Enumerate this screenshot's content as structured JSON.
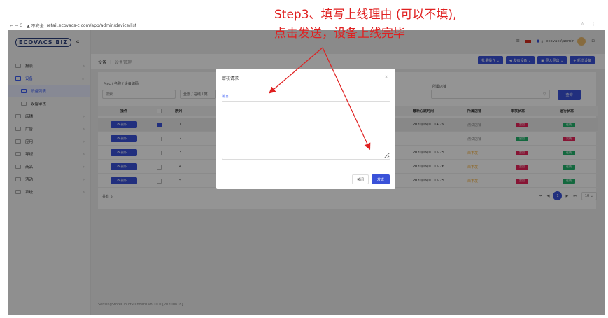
{
  "browser": {
    "nav": "← → C",
    "secure": "▲ 不安全",
    "url": "retail.ecovacs-c.com/app/admin/device\\list",
    "tools": "☆ ⋮"
  },
  "captions": {
    "line1": "Step3、填写上线理由 (可以不填),",
    "line2": "点击发送，设备上线完毕"
  },
  "logo": {
    "text": "ECOVACS BIZ",
    "collapse": "«"
  },
  "sidebar": {
    "items": [
      {
        "label": "报表"
      },
      {
        "label": "设备"
      },
      {
        "label": "设备列表"
      },
      {
        "label": "设备审核"
      },
      {
        "label": "店铺"
      },
      {
        "label": "广告"
      },
      {
        "label": "应用"
      },
      {
        "label": "导视"
      },
      {
        "label": "商品"
      },
      {
        "label": "活动"
      },
      {
        "label": "系统"
      }
    ]
  },
  "header": {
    "user": "ecovacs\\admin",
    "notif_count": "8"
  },
  "breadcrumb": {
    "root": "设备",
    "current": "设备管理"
  },
  "toolbar": {
    "batch": "批量操作 ⌄",
    "publish": "◀ 发布设备 ⌄",
    "import": "▣ 导入导出 ⌄",
    "add": "+ 新增设备"
  },
  "filters": {
    "mac_label": "Mac / 名称 / 设备编码",
    "search_placeholder": "搜索...",
    "status_value": "全部 / 在线 / 离",
    "store_label": "所属店铺",
    "search_btn": "查询"
  },
  "table": {
    "headers": [
      "操作",
      "序列",
      "最新心跳时间",
      "所属店铺",
      "审核状态",
      "运行状态"
    ],
    "op_label": "✿ 操作 ⌄",
    "rows": [
      {
        "seq": "1",
        "time": "2020/09/01 14:29",
        "store": "测试店铺",
        "audit": "禁用",
        "run": "在线",
        "checked": true
      },
      {
        "seq": "2",
        "time": "",
        "store": "测试店铺",
        "audit": "启用",
        "run": "离线",
        "checked": false
      },
      {
        "seq": "3",
        "time": "2020/09/01 15:25",
        "store": "未下发",
        "audit": "禁用",
        "run": "在线",
        "checked": false
      },
      {
        "seq": "4",
        "time": "2020/09/01 15:26",
        "store": "未下发",
        "audit": "禁用",
        "run": "在线",
        "checked": false
      },
      {
        "seq": "5",
        "time": "2020/09/01 15:25",
        "store": "未下发",
        "audit": "禁用",
        "run": "在线",
        "checked": false
      }
    ],
    "total": "共有 5"
  },
  "pager": {
    "first": "⏮",
    "prev": "◀",
    "page": "1",
    "next": "▶",
    "last": "⏭",
    "size": "10 ⌄"
  },
  "footer": "SensingStoreCloudStandard v8.10.0 [20200818]",
  "modal": {
    "title": "审核请求",
    "close": "×",
    "label": "消息",
    "cancel": "关闭",
    "send": "发送"
  },
  "colors": {
    "accent": "#3a52d9",
    "red": "#e8245a",
    "green": "#21b36b",
    "orange": "#f5a623",
    "annotation": "#e02020"
  }
}
